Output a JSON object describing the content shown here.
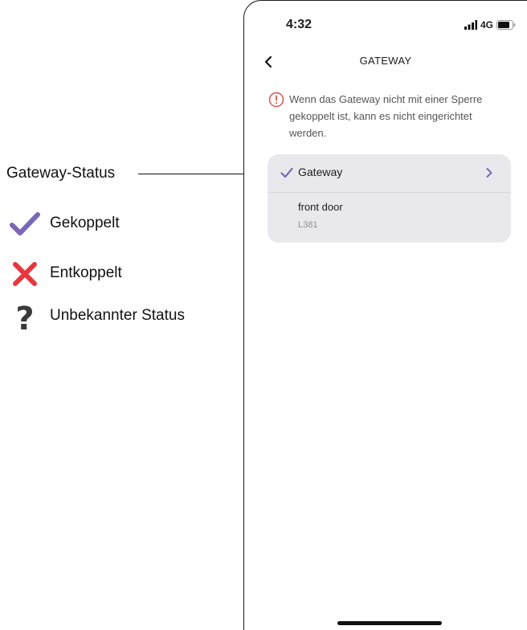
{
  "legend": {
    "callout_label": "Gateway-Status",
    "items": [
      {
        "label": "Gekoppelt",
        "icon": "check-icon",
        "color": "#7b68b5"
      },
      {
        "label": "Entkoppelt",
        "icon": "cross-icon",
        "color": "#e8363d"
      },
      {
        "label": "Unbekannter Status",
        "icon": "question-icon",
        "color": "#3a3a3a",
        "glyph": "?"
      }
    ]
  },
  "phone": {
    "status_bar": {
      "time": "4:32",
      "network": "4G"
    },
    "nav": {
      "title": "GATEWAY"
    },
    "warning": {
      "text": "Wenn das Gateway nicht mit einer Sperre gekoppelt ist, kann es nicht eingerichtet werden.",
      "color": "#d9534f"
    },
    "gateway_card": {
      "gateway_label": "Gateway",
      "status": "Gekoppelt",
      "lock_name": "front door",
      "lock_model": "L381",
      "accent": "#7b68b5"
    }
  }
}
